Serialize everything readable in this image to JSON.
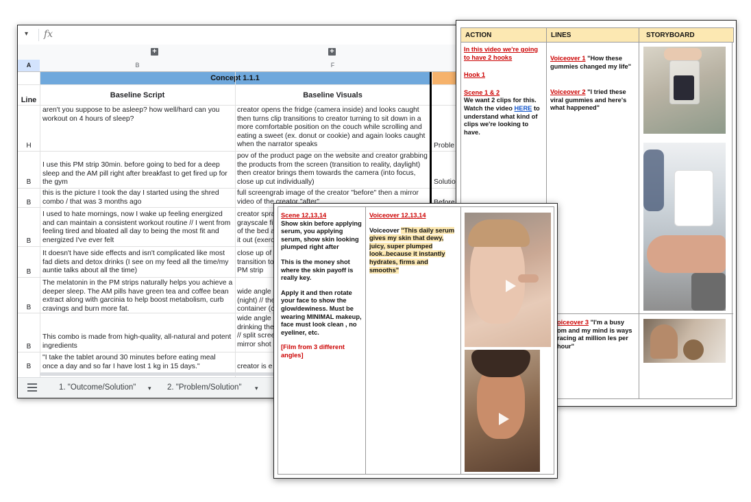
{
  "sheet": {
    "dropdown_glyph": "▾",
    "fx_label": "fx",
    "group_plus": "+",
    "columns": {
      "row_header": "A",
      "b": "B",
      "f": "F"
    },
    "concept_title": "Concept 1.1.1",
    "headers": {
      "line": "Line",
      "script": "Baseline Script",
      "visuals": "Baseline Visuals"
    },
    "rows": [
      {
        "line": "H",
        "script": "aren't you suppose to be asleep? how well/hard can you workout on 4 hours of sleep?",
        "visuals": "creator opens the fridge (camera inside) and looks caught then turns clip transitions to creator turning to sit down in a more comfortable position on the couch while scrolling and eating a sweet (ex. donut or cookie) and again looks caught when the narrator speaks",
        "extra": "Proble"
      },
      {
        "line": "B",
        "script": "I use this PM strip 30min. before going to bed for a deep sleep and the AM pill right after breakfast to get fired up for the gym",
        "visuals": "pov of the product page on the website and creator grabbing the products from the screen (transition to reality, daylight) then creator brings them towards the camera (into focus, close up cut individually)",
        "extra": "Solutio"
      },
      {
        "line": "B",
        "script": "this is the picture I took the day I started using the shred combo / that was 3 months ago",
        "visuals": "full screengrab image of the creator \"before\" then a mirror video of the creator \"after\"",
        "extra": "Before"
      },
      {
        "line": "B",
        "script": "I used to hate mornings, now I wake up feeling energized and can maintain a consistent workout routine // I went from feeling tired and bloated all day to being the most fit and energized I've ever felt",
        "visuals": "creator spra grayscale fi of the bed a it out (exerc",
        "extra": ""
      },
      {
        "line": "B",
        "script": "It doesn't have side effects and isn't complicated like most fad diets and detox drinks (I see on my feed all the time/my auntie talks about all the time)",
        "visuals": "close up of transition to PM strip",
        "extra": ""
      },
      {
        "line": "B",
        "script": "The melatonin in the PM strips naturally helps you achieve a deeper sleep. The AM pills have green tea and coffee bean extract along with garcinia to help boost metabolism, curb cravings and burn more fat.",
        "visuals": "wide angle (night) // the container (c",
        "extra": ""
      },
      {
        "line": "B",
        "script": "This combo is made from high-quality, all-natural and potent ingredients",
        "visuals": "wide angle drinking the // split scree mirror shot",
        "extra": ""
      },
      {
        "line": "B",
        "script": "\"I take the tablet around 30 minutes before eating meal once a day and so far I have lost 1 kg in 15 days.\"",
        "visuals": "creator is e",
        "extra": ""
      }
    ],
    "tabs": {
      "tab1": "1. \"Outcome/Solution\"",
      "tab2": "2. \"Problem/Solution\"",
      "arrow": "▾"
    }
  },
  "story": {
    "headers": {
      "action": "ACTION",
      "lines": "LINES",
      "storyboard": "STORYBOARD"
    },
    "action": {
      "intro": "In this video we're going to have 2 hooks",
      "hook": "Hook 1",
      "scene": "Scene 1 & 2",
      "body_pre": "We want 2 clips for this. Watch the video ",
      "link": "HERE",
      "body_post": " to understand what kind of clips we're looking to have."
    },
    "lines": {
      "vo1_label": "Voiceover 1",
      "vo1_text": " \"How these gummies changed my life\"",
      "vo2_label": "Voiceover 2",
      "vo2_text": " \"I tried these viral gummies and here's what happened\"",
      "vo3_label": "oiceover 3",
      "vo3_text": " \"I'm a busy om and my mind is ways racing at million les per hour\""
    }
  },
  "scene": {
    "scene_label": "Scene 12,13,14",
    "direction1": "Show skin before applying serum, you applying serum, show skin looking plumped right after",
    "direction2": "This is the money shot where the skin payoff is really key.",
    "direction3": "Apply it and then rotate your face to show the glow/dewiness. Must be wearing MINIMAL makeup, face must look clean , no eyeliner, etc.",
    "direction4": "[Film from 3 different angles]",
    "vo_label": "Voiceover 12,13,14",
    "vo_prefix": "Voiceover ",
    "vo_text": "\"This daily serum gives my skin that dewy, juicy, super plumped look..because it instantly hydrates, firms and smooths\""
  },
  "colors": {
    "concept_blue": "#6fa8dc",
    "concept_orange": "#f6b26b",
    "header_yellow": "#fce8b2",
    "red": "#cc0000",
    "link_blue": "#1155cc"
  }
}
